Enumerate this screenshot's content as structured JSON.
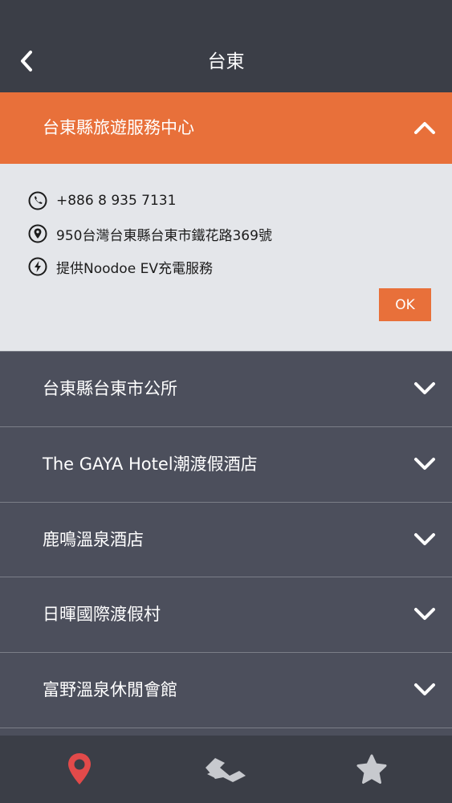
{
  "header": {
    "title": "台東"
  },
  "expanded": {
    "title": "台東縣旅遊服務中心",
    "phone": "+886 8 935 7131",
    "address": "950台灣台東縣台東市鐵花路369號",
    "service": "提供Noodoe EV充電服務",
    "ok_label": "OK"
  },
  "locations": [
    {
      "label": "台東縣台東市公所"
    },
    {
      "label": "The GAYA Hotel潮渡假酒店"
    },
    {
      "label": "鹿鳴溫泉酒店"
    },
    {
      "label": "日暉國際渡假村"
    },
    {
      "label": "富野溫泉休閒會館"
    }
  ],
  "tabs": [
    {
      "icon": "map-pin-icon",
      "active": true
    },
    {
      "icon": "route-icon",
      "active": false
    },
    {
      "icon": "star-icon",
      "active": false
    }
  ],
  "colors": {
    "accent": "#e8703a",
    "background": "#4c4f5c",
    "bar": "#3b3e47",
    "active_tab": "#e24a4a",
    "inactive_tab": "#c7c9ce"
  }
}
